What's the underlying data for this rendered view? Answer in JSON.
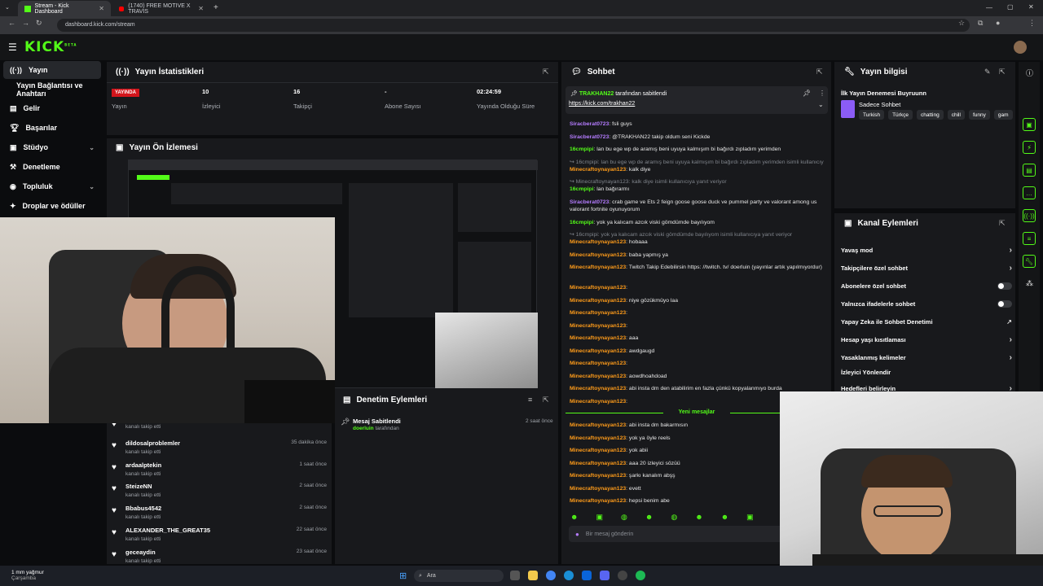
{
  "browser": {
    "tabs": [
      {
        "title": "Stream - Kick Dashboard",
        "active": true
      },
      {
        "title": "(1740) FREE MOTIVE X TRAVIS",
        "active": false
      }
    ],
    "url": "dashboard.kick.com/stream"
  },
  "app": {
    "logo": "KICK",
    "logo_sup": "BETA"
  },
  "sidebar": {
    "items": [
      {
        "label": "Yayın"
      },
      {
        "label": "Yayın Bağlantısı ve Anahtarı"
      },
      {
        "label": "Gelir"
      },
      {
        "label": "Başarılar"
      },
      {
        "label": "Stüdyo"
      },
      {
        "label": "Denetleme"
      },
      {
        "label": "Topluluk"
      },
      {
        "label": "Droplar ve ödüller"
      }
    ]
  },
  "stats": {
    "title": "Yayın İstatistikleri",
    "live_badge": "YAYINDA",
    "items": [
      {
        "value": "",
        "label": "Yayın"
      },
      {
        "value": "10",
        "label": "İzleyici"
      },
      {
        "value": "16",
        "label": "Takipçi"
      },
      {
        "value": "-",
        "label": "Abone Sayısı"
      },
      {
        "value": "02:24:59",
        "label": "Yayında Olduğu Süre"
      }
    ]
  },
  "preview": {
    "title": "Yayın Ön İzlemesi"
  },
  "followers": {
    "rows": [
      {
        "name": "",
        "sub": "kanalı takip etti",
        "time": ""
      },
      {
        "name": "dildosalproblemler",
        "sub": "kanalı takip etti",
        "time": "35 dakika önce"
      },
      {
        "name": "ardaalptekin",
        "sub": "kanalı takip etti",
        "time": "1 saat önce"
      },
      {
        "name": "SteizeNN",
        "sub": "kanalı takip etti",
        "time": "2 saat önce"
      },
      {
        "name": "Bbabus4542",
        "sub": "kanalı takip etti",
        "time": "2 saat önce"
      },
      {
        "name": "ALEXANDER_THE_GREAT35",
        "sub": "kanalı takip etti",
        "time": "22 saat önce"
      },
      {
        "name": "geceaydin",
        "sub": "kanalı takip etti",
        "time": "23 saat önce"
      }
    ]
  },
  "moderation": {
    "title": "Denetim Eylemleri",
    "event_title": "Mesaj Sabitlendi",
    "event_user": "doerluin",
    "event_suffix": "tarafından",
    "event_time": "2 saat önce"
  },
  "chat": {
    "title": "Sohbet",
    "pinned_by": "TRAKHAN22",
    "pinned_suffix": "tarafından sabitlendi",
    "pinned_link": "https://kick.com/trakhan22",
    "new_messages": "Yeni mesajlar",
    "input_placeholder": "Bir mesaj gönderin",
    "messages": [
      {
        "user": "Siracberat0723",
        "color": "#b57cff",
        "text": "fsli guys"
      },
      {
        "user": "Siracberat0723",
        "color": "#b57cff",
        "text": "@TRAKHAN22 takip oldum seni Kickde"
      },
      {
        "user": "16cmpipi",
        "color": "#53fc18",
        "text": "lan bu ege wp de aramış beni uyuya kalmışım bi bağırdı zıpladım yerimden"
      },
      {
        "user": "",
        "color": "#7f848b",
        "text": "16cmpipi: lan bu ege wp de aramış beni uyuya kalmışım bi bağırdı zıpladım yerimden isimli kullanıcıya yan..."
      },
      {
        "user": "Minecraftoynayan123",
        "color": "#ff9c1a",
        "text": "kalk diye"
      },
      {
        "user": "",
        "color": "#7f848b",
        "text": "Minecraftoynayan123: kalk diye isimli kullanıcıya yanıt veriyor"
      },
      {
        "user": "16cmpipi",
        "color": "#53fc18",
        "text": "lan bağırarmı"
      },
      {
        "user": "Siracberat0723",
        "color": "#b57cff",
        "text": "crab game ve Ets 2 feign goose goose duck ve pummel party ve valorant among us valorant fortnite oyunuyorum"
      },
      {
        "user": "16cmpipi",
        "color": "#53fc18",
        "text": "yok ya kalıcam azcık viski gömdümde bayılıyom"
      },
      {
        "user": "",
        "color": "#7f848b",
        "text": "16cmpipi: yok ya kalıcam azcık viski gömdümde bayılıyom isimli kullanıcıya yanıt veriyor"
      },
      {
        "user": "Minecraftoynayan123",
        "color": "#ff9c1a",
        "text": "hobaaa"
      },
      {
        "user": "Minecraftoynayan123",
        "color": "#ff9c1a",
        "text": "baba yapmış ya"
      },
      {
        "user": "Minecraftoynayan123",
        "color": "#ff9c1a",
        "text": "Twitch Takip Edebilirsin https: //twitch. tv/ doerluin (yayınlar artık yapılmıyordur)"
      },
      {
        "user": "Minecraftoynayan123",
        "color": "#ff9c1a",
        "text": ""
      },
      {
        "user": "Minecraftoynayan123",
        "color": "#ff9c1a",
        "text": "niye gözükmüyo laa"
      },
      {
        "user": "Minecraftoynayan123",
        "color": "#ff9c1a",
        "text": ""
      },
      {
        "user": "Minecraftoynayan123",
        "color": "#ff9c1a",
        "text": ""
      },
      {
        "user": "Minecraftoynayan123",
        "color": "#ff9c1a",
        "text": "aaa"
      },
      {
        "user": "Minecraftoynayan123",
        "color": "#ff9c1a",
        "text": "awdgaugd"
      },
      {
        "user": "Minecraftoynayan123",
        "color": "#ff9c1a",
        "text": ""
      },
      {
        "user": "Minecraftoynayan123",
        "color": "#ff9c1a",
        "text": "aowdhoahdoad"
      },
      {
        "user": "Minecraftoynayan123",
        "color": "#ff9c1a",
        "text": "abi insta dm den atabilirim en fazla çünkü kopyalanmıyo burda"
      },
      {
        "user": "Minecraftoynayan123",
        "color": "#ff9c1a",
        "text": ""
      }
    ],
    "new_msgs": [
      {
        "user": "Minecraftoynayan123",
        "color": "#ff9c1a",
        "text": "abi insta dm bakarmısın"
      },
      {
        "user": "Minecraftoynayan123",
        "color": "#ff9c1a",
        "text": "yok ya öyle reels"
      },
      {
        "user": "Minecraftoynayan123",
        "color": "#ff9c1a",
        "text": "yok abii"
      },
      {
        "user": "Minecraftoynayan123",
        "color": "#ff9c1a",
        "text": "aaa 20 izleyici sözüü"
      },
      {
        "user": "Minecraftoynayan123",
        "color": "#ff9c1a",
        "text": "şarkı kanalım abşş"
      },
      {
        "user": "Minecraftoynayan123",
        "color": "#ff9c1a",
        "text": "evett"
      },
      {
        "user": "Minecraftoynayan123",
        "color": "#ff9c1a",
        "text": "hepsi benim abe"
      }
    ]
  },
  "stream_info": {
    "title": "Yayın bilgisi",
    "stream_title": "İlk Yayın Denemesi Buyruunn",
    "category": "Sadece Sohbet",
    "tags": [
      "Turkish",
      "Türkçe",
      "chatting",
      "chill",
      "funny",
      "gam"
    ]
  },
  "channel_actions": {
    "title": "Kanal Eylemleri",
    "items": [
      {
        "label": "Yavaş mod",
        "control": "chevron"
      },
      {
        "label": "Takipçilere özel sohbet",
        "control": "chevron"
      },
      {
        "label": "Abonelere özel sohbet",
        "control": "toggle"
      },
      {
        "label": "Yalnızca ifadelerle sohbet",
        "control": "toggle"
      },
      {
        "label": "Yapay Zeka ile Sohbet Denetimi",
        "control": "external"
      },
      {
        "label": "Hesap yaşı kısıtlaması",
        "control": "chevron"
      },
      {
        "label": "Yasaklanmış kelimeler",
        "control": "chevron"
      },
      {
        "label": "İzleyici Yönlendir",
        "control": "none"
      },
      {
        "label": "Hedefleri belirleyin",
        "control": "chevron"
      }
    ]
  },
  "taskbar": {
    "weather_line1": "1 mm yağmur",
    "weather_line2": "Çarşamba",
    "search_placeholder": "Ara"
  },
  "colors": {
    "accent": "#53fc18",
    "live": "#d2151c"
  }
}
